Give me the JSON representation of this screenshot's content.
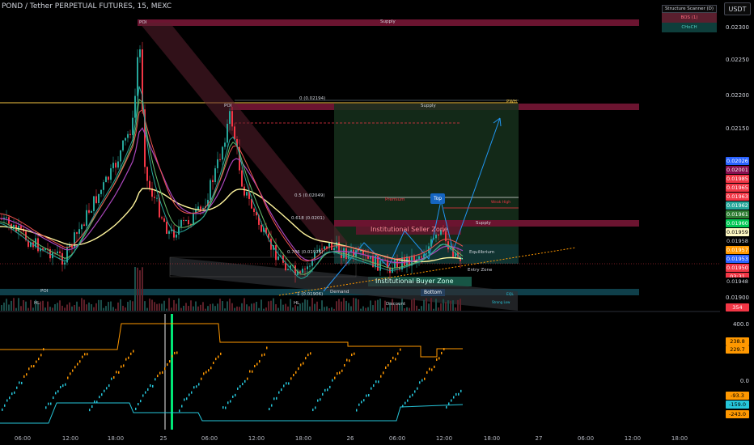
{
  "window": {
    "title": "POND / Tether PERPETUAL FUTURES, 15, MEXC"
  },
  "currency_button": "USDT",
  "structure_scanner": {
    "title": "Structure Scanner (D)",
    "bos": "BOS (1)",
    "choch": "CHoCH"
  },
  "zones": {
    "supply_top": "Supply",
    "supply_mid": "Supply",
    "supply_right": "Supply",
    "pwh": "PWH",
    "fib_0": "0 (0.02194)",
    "fib_05": "0.5 (0.02049)",
    "fib_0618": "0.618 (0.0201)",
    "fib_0786": "0.786 (0.01976)",
    "premium": "Premium",
    "weak_high": "Weak High",
    "equilibrium": "Equilibrium",
    "entry_zone": "Entry Zone",
    "institutional_seller": "Institutional Seller Zone",
    "institutional_buyer": "Institutional Buyer Zone",
    "demand": "Demand",
    "discount": "Discount",
    "top": "Top",
    "bottom": "Bottom",
    "poi_top": "POI",
    "poi_mid": "POI",
    "poi_low": "POI",
    "hl_left": "HL",
    "hl_mid": "HL",
    "strong_low": "Strong Low",
    "eql": "EQL",
    "fib_1": "1 (0.01906)"
  },
  "price_scale": {
    "ticks": [
      "0.02300",
      "0.02250",
      "0.02200",
      "0.02150",
      "0.01900",
      "400.0",
      "0.0"
    ],
    "labels": [
      {
        "text": "0.02026",
        "color": "#2962ff"
      },
      {
        "text": "0.02001",
        "color": "#880e4f"
      },
      {
        "text": "0.01985",
        "color": "#f23645"
      },
      {
        "text": "0.01965",
        "color": "#f23645"
      },
      {
        "text": "0.01963",
        "color": "#f23645"
      },
      {
        "text": "0.01962",
        "color": "#26a69a"
      },
      {
        "text": "0.01961",
        "color": "#2e7d32"
      },
      {
        "text": "0.01960",
        "color": "#00c853"
      },
      {
        "text": "0.01959",
        "color": "#fff9c4"
      },
      {
        "text": "0.01958",
        "color": "#000000"
      },
      {
        "text": "0.01957",
        "color": "#ff9800"
      },
      {
        "text": "0.01953",
        "color": "#2962ff"
      },
      {
        "text": "0.01950",
        "color": "#f23645"
      },
      {
        "text": "03:31",
        "color": "#f23645"
      },
      {
        "text": "0.01948",
        "color": "#000000"
      },
      {
        "text": "354",
        "color": "#f23645"
      }
    ],
    "osc_labels": [
      {
        "text": "238.8",
        "color": "#ff9800"
      },
      {
        "text": "229.7",
        "color": "#ff9800"
      },
      {
        "text": "-93.3",
        "color": "#ff9800"
      },
      {
        "text": "-159.0",
        "color": "#26c6da"
      },
      {
        "text": "-243.0",
        "color": "#ff9800"
      }
    ]
  },
  "time_axis": [
    "06:00",
    "12:00",
    "18:00",
    "25",
    "06:00",
    "12:00",
    "18:00",
    "26",
    "06:00",
    "12:00",
    "18:00",
    "27",
    "06:00",
    "12:00",
    "18:00"
  ],
  "colors": {
    "up": "#26a69a",
    "down": "#f23645",
    "supply": "#6b1430",
    "demand": "#0f3f4a",
    "premium_box": "#16301c",
    "osc_orange": "#ff9800",
    "osc_cyan": "#26c6da"
  }
}
